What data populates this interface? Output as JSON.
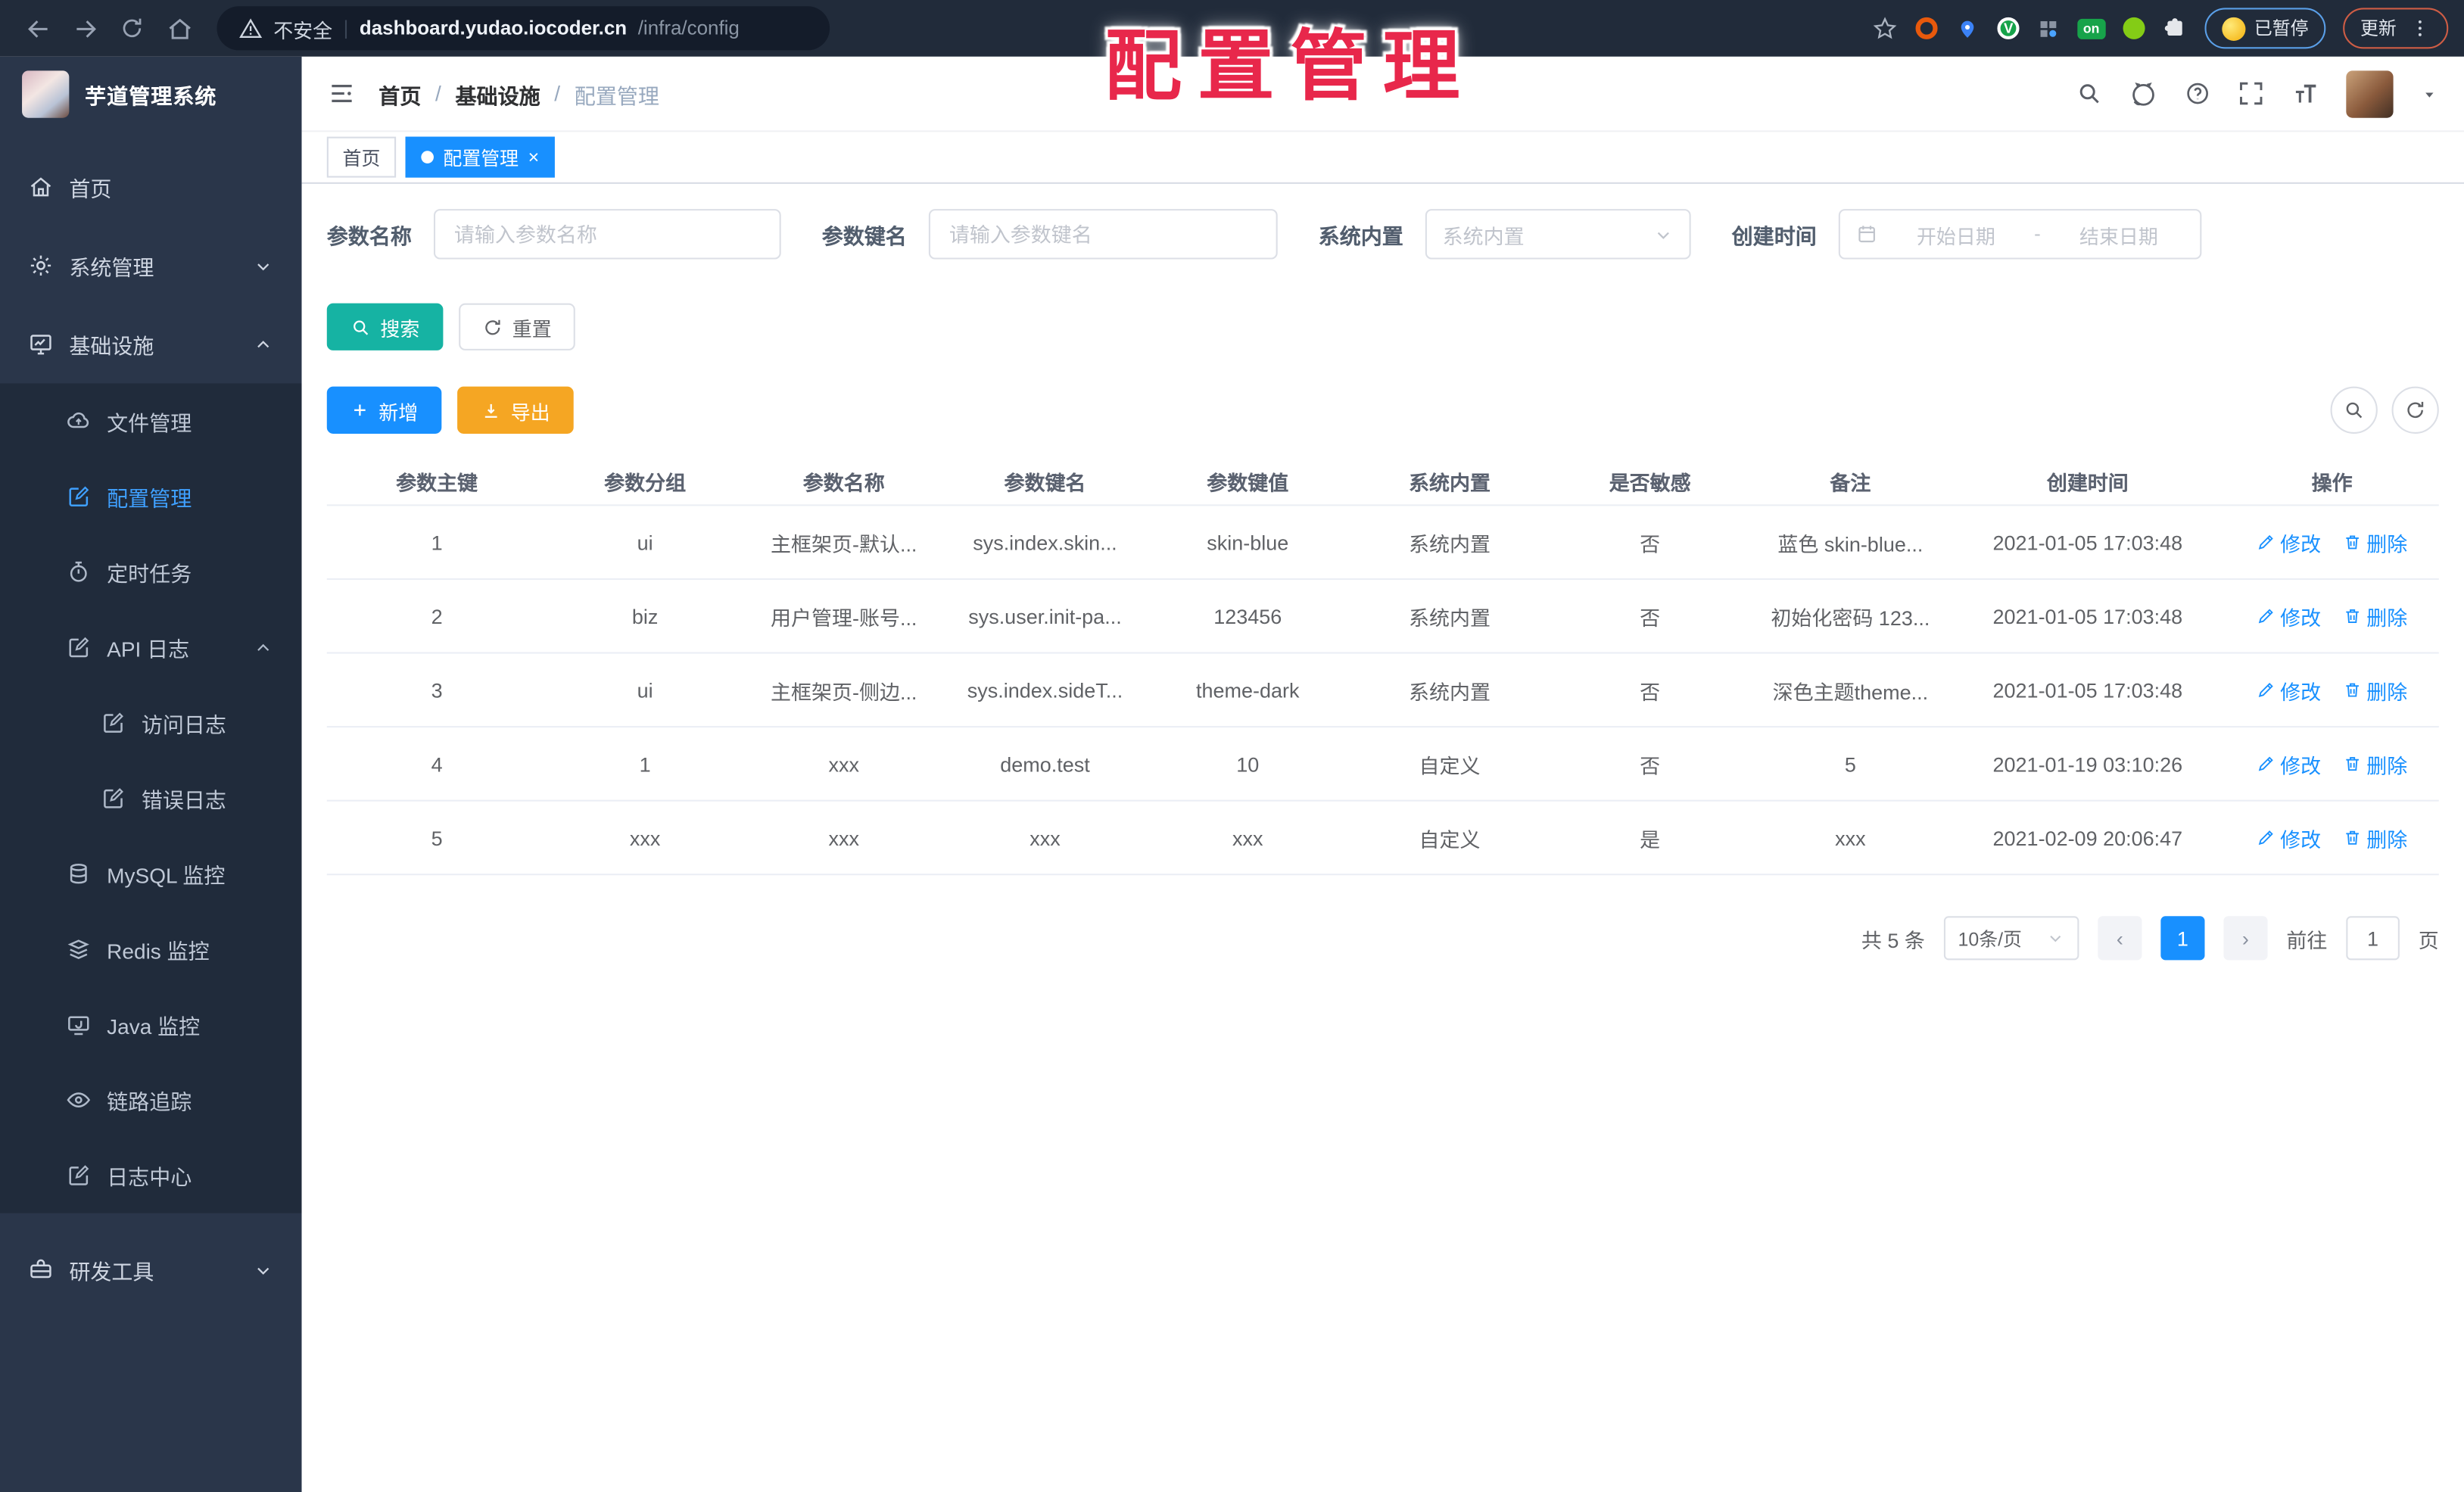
{
  "browser": {
    "security_label": "不安全",
    "url_host": "dashboard.yudao.iocoder.cn",
    "url_path": "/infra/config",
    "paused_label": "已暂停",
    "update_label": "更新"
  },
  "overlay": {
    "title": "配置管理"
  },
  "sidebar": {
    "app_title": "芋道管理系统",
    "items": [
      {
        "label": "首页"
      },
      {
        "label": "系统管理"
      },
      {
        "label": "基础设施"
      },
      {
        "label": "文件管理"
      },
      {
        "label": "配置管理"
      },
      {
        "label": "定时任务"
      },
      {
        "label": "API 日志"
      },
      {
        "label": "访问日志"
      },
      {
        "label": "错误日志"
      },
      {
        "label": "MySQL 监控"
      },
      {
        "label": "Redis 监控"
      },
      {
        "label": "Java 监控"
      },
      {
        "label": "链路追踪"
      },
      {
        "label": "日志中心"
      },
      {
        "label": "研发工具"
      }
    ]
  },
  "breadcrumb": {
    "items": [
      "首页",
      "基础设施",
      "配置管理"
    ]
  },
  "tabs": {
    "home": "首页",
    "active": "配置管理"
  },
  "filters": {
    "name_label": "参数名称",
    "name_placeholder": "请输入参数名称",
    "key_label": "参数键名",
    "key_placeholder": "请输入参数键名",
    "type_label": "系统内置",
    "type_placeholder": "系统内置",
    "date_label": "创建时间",
    "date_start_placeholder": "开始日期",
    "date_separator": "-",
    "date_end_placeholder": "结束日期",
    "search_button": "搜索",
    "reset_button": "重置",
    "add_button": "新增",
    "export_button": "导出"
  },
  "table": {
    "columns": [
      "参数主键",
      "参数分组",
      "参数名称",
      "参数键名",
      "参数键值",
      "系统内置",
      "是否敏感",
      "备注",
      "创建时间",
      "操作"
    ],
    "edit_label": "修改",
    "delete_label": "删除",
    "rows": [
      {
        "pk": "1",
        "group": "ui",
        "name": "主框架页-默认...",
        "key": "sys.index.skin...",
        "value": "skin-blue",
        "builtin": "系统内置",
        "sensitive": "否",
        "remark": "蓝色 skin-blue...",
        "created": "2021-01-05 17:03:48"
      },
      {
        "pk": "2",
        "group": "biz",
        "name": "用户管理-账号...",
        "key": "sys.user.init-pa...",
        "value": "123456",
        "builtin": "系统内置",
        "sensitive": "否",
        "remark": "初始化密码 123...",
        "created": "2021-01-05 17:03:48"
      },
      {
        "pk": "3",
        "group": "ui",
        "name": "主框架页-侧边...",
        "key": "sys.index.sideT...",
        "value": "theme-dark",
        "builtin": "系统内置",
        "sensitive": "否",
        "remark": "深色主题theme...",
        "created": "2021-01-05 17:03:48"
      },
      {
        "pk": "4",
        "group": "1",
        "name": "xxx",
        "key": "demo.test",
        "value": "10",
        "builtin": "自定义",
        "sensitive": "否",
        "remark": "5",
        "created": "2021-01-19 03:10:26"
      },
      {
        "pk": "5",
        "group": "xxx",
        "name": "xxx",
        "key": "xxx",
        "value": "xxx",
        "builtin": "自定义",
        "sensitive": "是",
        "remark": "xxx",
        "created": "2021-02-09 20:06:47"
      }
    ]
  },
  "pagination": {
    "total": "共 5 条",
    "page_size": "10条/页",
    "prev": "‹",
    "next": "›",
    "current": "1",
    "goto_label": "前往",
    "goto_value": "1",
    "unit_label": "页"
  },
  "colors": {
    "accent_blue": "#1890ff",
    "teal": "#16b3a3",
    "amber": "#f5a623",
    "overlay_red": "#e8274b",
    "sidebar_bg": "#2a364a",
    "submenu_bg": "#202b3b",
    "chrome_bg": "#212b3a"
  }
}
